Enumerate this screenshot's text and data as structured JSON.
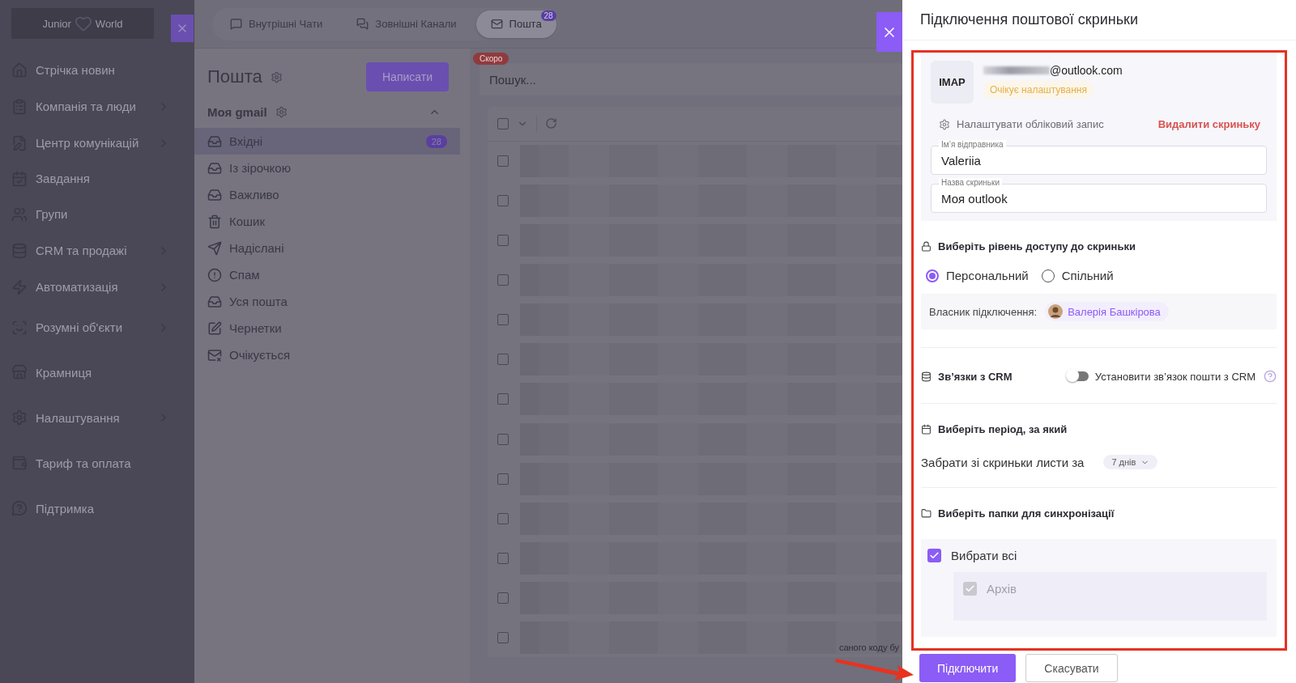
{
  "sidebar": {
    "logo": [
      "Junior",
      "World"
    ],
    "items": [
      {
        "label": "Стрічка новин",
        "chevron": false
      },
      {
        "label": "Компанія та люди",
        "chevron": true
      },
      {
        "label": "Центр комунікацій",
        "chevron": true
      },
      {
        "label": "Завдання",
        "chevron": false
      },
      {
        "label": "Групи",
        "chevron": false
      },
      {
        "label": "CRM та продажі",
        "chevron": true
      },
      {
        "label": "Автоматизація",
        "chevron": true
      },
      {
        "label": "Розумні об'єкти",
        "chevron": true
      },
      {
        "label": "Крамниця",
        "chevron": false
      },
      {
        "label": "Налаштування",
        "chevron": true
      },
      {
        "label": "Тариф та оплата",
        "chevron": false
      },
      {
        "label": "Підтримка",
        "chevron": false
      }
    ]
  },
  "top_tabs": [
    {
      "label": "Внутрішні Чати",
      "selected": false
    },
    {
      "label": "Зовнішні Канали",
      "selected": false
    },
    {
      "label": "Пошта",
      "selected": true,
      "badge": "28"
    }
  ],
  "mail": {
    "title": "Пошта",
    "compose": "Написати",
    "account": "Моя gmail",
    "expanded": true,
    "folders": [
      {
        "label": "Вхідні",
        "selected": true,
        "count": "28"
      },
      {
        "label": "Із зірочкою",
        "selected": false
      },
      {
        "label": "Важливо",
        "selected": false
      },
      {
        "label": "Кошик",
        "selected": false
      },
      {
        "label": "Надіслані",
        "selected": false
      },
      {
        "label": "Спам",
        "selected": false
      },
      {
        "label": "Уся пошта",
        "selected": false
      },
      {
        "label": "Чернетки",
        "selected": false
      },
      {
        "label": "Очікується",
        "selected": false
      }
    ]
  },
  "list": {
    "search_placeholder": "Пошук...",
    "soon_badge": "Скоро",
    "select_all_checked": false,
    "rows": [
      {
        "checked": false
      },
      {
        "checked": false
      },
      {
        "checked": false
      },
      {
        "checked": false
      },
      {
        "checked": false
      },
      {
        "checked": false
      },
      {
        "checked": false
      },
      {
        "checked": false
      },
      {
        "checked": false
      },
      {
        "checked": false
      },
      {
        "checked": false
      },
      {
        "checked": false
      },
      {
        "checked": false
      }
    ],
    "footer_fragment": "саного коду бу"
  },
  "drawer": {
    "title": "Підключення поштової скриньки",
    "protocol": "IMAP",
    "email": "@outlook.com",
    "status": "Очікує налаштування",
    "configure": "Налаштувати обліковий запис",
    "delete": "Видалити скриньку",
    "fields": [
      {
        "label": "Ім’я відправника",
        "value": "Valeriia"
      },
      {
        "label": "Назва скриньки",
        "value": "Моя outlook"
      }
    ],
    "access": {
      "heading": "Виберіть рівень доступу до скриньки",
      "options": [
        {
          "label": "Персональний",
          "selected": true
        },
        {
          "label": "Спільний",
          "selected": false
        }
      ],
      "owner_label": "Власник підключення:",
      "owner": "Валерія Башкірова"
    },
    "crm": {
      "heading": "Зв’язки з CRM",
      "toggle_label": "Установити зв’язок пошти з CRM",
      "on": false
    },
    "period": {
      "heading": "Виберіть період, за який",
      "label": "Забрати зі скриньки листи за",
      "value": "7 днів"
    },
    "folders": {
      "heading": "Виберіть папки для синхронізації",
      "select_all": {
        "label": "Вибрати всі",
        "checked": true
      },
      "items": [
        {
          "label": "Архів",
          "checked": true,
          "disabled": true
        }
      ]
    },
    "buttons": [
      {
        "label": "Підключити",
        "kind": "primary"
      },
      {
        "label": "Скасувати",
        "kind": "secondary"
      }
    ]
  }
}
